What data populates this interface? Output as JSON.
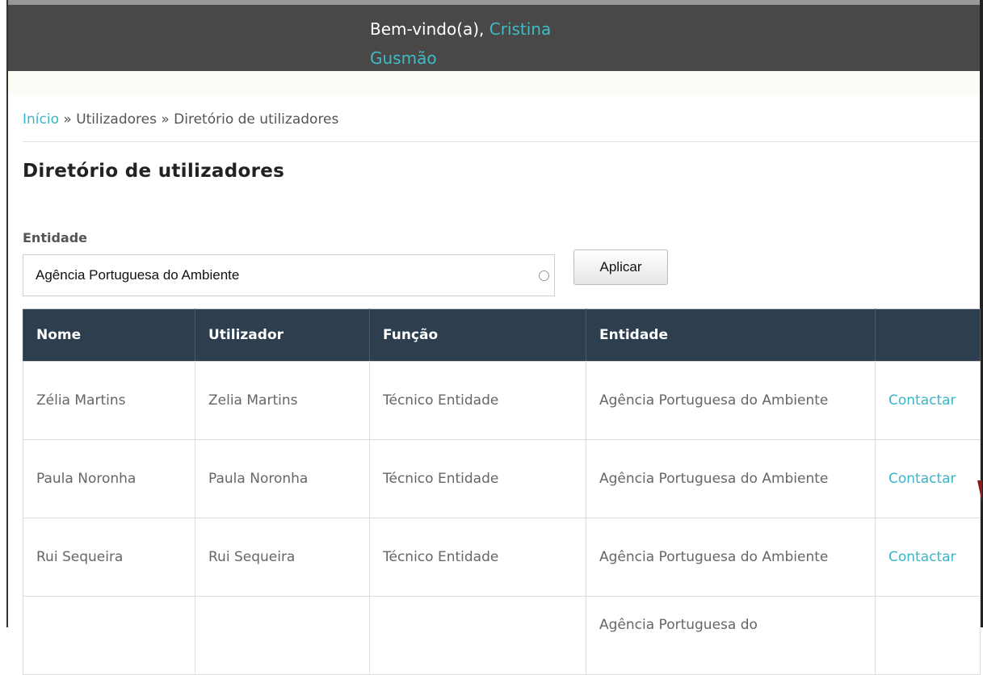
{
  "header": {
    "welcome_prefix": "Bem-vindo(a), ",
    "user_name": "Cristina Gusmão"
  },
  "breadcrumb": {
    "home": "Início",
    "separator1": " » ",
    "users": "Utilizadores",
    "separator2": " » ",
    "current": "Diretório de utilizadores"
  },
  "page": {
    "title": "Diretório de utilizadores"
  },
  "filter": {
    "label": "Entidade",
    "selected": "Agência Portuguesa do Ambiente",
    "apply_label": "Aplicar"
  },
  "table": {
    "columns": [
      "Nome",
      "Utilizador",
      "Função",
      "Entidade",
      ""
    ],
    "rows": [
      {
        "nome": "Zélia Martins",
        "utilizador": "Zelia Martins",
        "funcao": "Técnico Entidade",
        "entidade": "Agência Portuguesa do Ambiente",
        "acao": "Contactar"
      },
      {
        "nome": "Paula Noronha",
        "utilizador": "Paula Noronha",
        "funcao": "Técnico Entidade",
        "entidade": "Agência Portuguesa do Ambiente",
        "acao": "Contactar"
      },
      {
        "nome": "Rui Sequeira",
        "utilizador": "Rui Sequeira",
        "funcao": "Técnico Entidade",
        "entidade": "Agência Portuguesa do Ambiente",
        "acao": "Contactar"
      },
      {
        "nome": "",
        "utilizador": "",
        "funcao": "",
        "entidade": "Agência Portuguesa do",
        "acao": ""
      }
    ]
  },
  "colors": {
    "accent": "#3ab5c6",
    "header_bg": "#4a4847",
    "table_header_bg": "#2d3e4f"
  }
}
